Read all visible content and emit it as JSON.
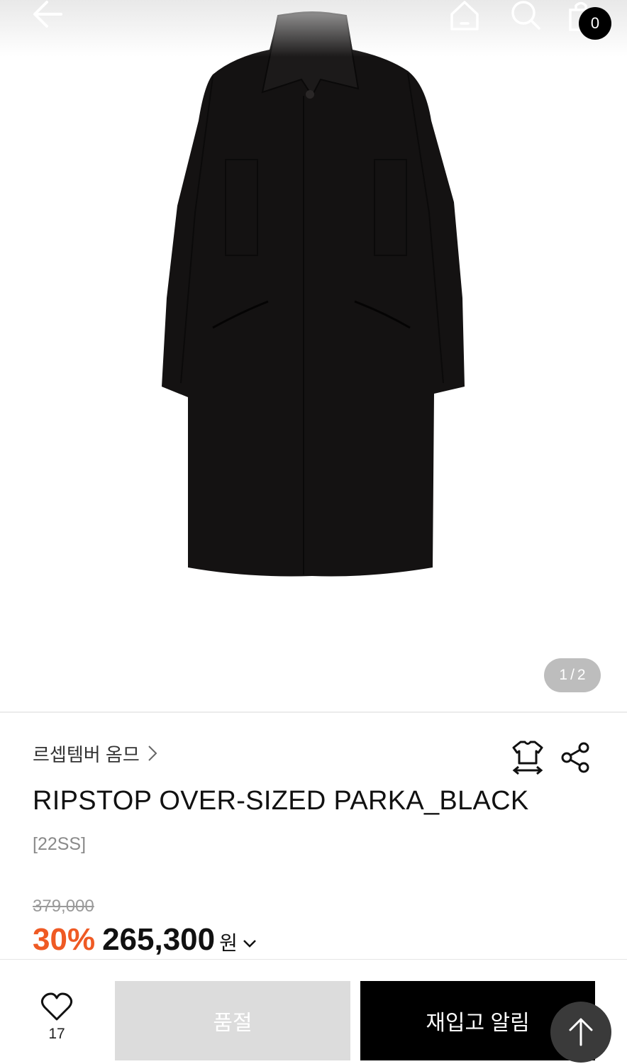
{
  "header": {
    "back_icon": "arrow-left-icon",
    "home_icon": "home-icon",
    "search_icon": "search-icon",
    "cart_icon": "shopping-bag-icon",
    "cart_count": "0"
  },
  "gallery": {
    "current": "1",
    "separator": "/",
    "total": "2"
  },
  "product": {
    "brand": "르셉템버 옴므",
    "title": "RIPSTOP OVER-SIZED PARKA_BLACK",
    "season": "[22SS]",
    "original_price": "379,000",
    "discount": "30%",
    "price": "265,300",
    "currency": "원"
  },
  "actions": {
    "like_count": "17",
    "soldout_label": "품절",
    "restock_label": "재입고 알림"
  },
  "colors": {
    "accent": "#ef5a24",
    "primary_button": "#000000",
    "disabled_button": "#dcdcdc"
  }
}
